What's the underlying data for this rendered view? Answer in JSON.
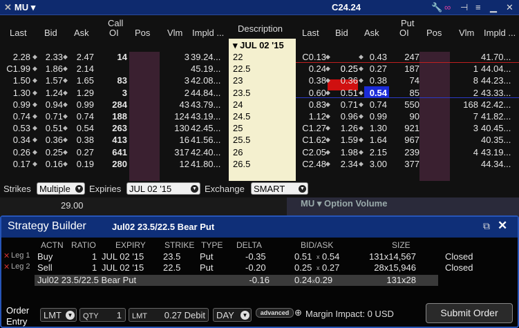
{
  "window": {
    "symbol": "MU",
    "price": "C24.24"
  },
  "chain": {
    "call_header": "Call",
    "put_header": "Put",
    "columns": {
      "last": "Last",
      "bid": "Bid",
      "ask": "Ask",
      "oi": "OI",
      "pos": "Pos",
      "vlm": "Vlm",
      "impld": "Impld ...",
      "description": "Description"
    },
    "expiry": "JUL 02 '15",
    "rows": [
      {
        "c_last": "2.28",
        "c_bid": "2.33",
        "c_ask": "2.47",
        "c_oi": "14",
        "c_vlm": "3",
        "c_impld": "39.24...",
        "strike": "22",
        "p_last": "C0.13",
        "p_bid": "",
        "p_ask": "0.43",
        "p_oi": "247",
        "p_vlm": "",
        "p_impld": "41.70..."
      },
      {
        "c_last": "C1.99",
        "c_bid": "1.86",
        "c_ask": "2.14",
        "c_oi": "",
        "c_vlm": "",
        "c_impld": "45.19...",
        "strike": "22.5",
        "p_last": "0.24",
        "p_bid": "0.25",
        "p_ask": "0.27",
        "p_oi": "187",
        "p_vlm": "1",
        "p_impld": "44.04..."
      },
      {
        "c_last": "1.50",
        "c_bid": "1.57",
        "c_ask": "1.65",
        "c_oi": "83",
        "c_vlm": "3",
        "c_impld": "42.08...",
        "strike": "23",
        "p_last": "0.38",
        "p_bid": "0.36",
        "p_ask": "0.38",
        "p_oi": "74",
        "p_vlm": "8",
        "p_impld": "44.23..."
      },
      {
        "c_last": "1.30",
        "c_bid": "1.24",
        "c_ask": "1.29",
        "c_oi": "3",
        "c_vlm": "2",
        "c_impld": "44.84...",
        "strike": "23.5",
        "p_last": "0.60",
        "p_bid": "0.51",
        "p_ask": "0.54",
        "p_oi": "85",
        "p_vlm": "2",
        "p_impld": "43.33..."
      },
      {
        "c_last": "0.99",
        "c_bid": "0.94",
        "c_ask": "0.99",
        "c_oi": "284",
        "c_vlm": "43",
        "c_impld": "43.79...",
        "strike": "24",
        "p_last": "0.83",
        "p_bid": "0.71",
        "p_ask": "0.74",
        "p_oi": "550",
        "p_vlm": "168",
        "p_impld": "42.42..."
      },
      {
        "c_last": "0.74",
        "c_bid": "0.71",
        "c_ask": "0.74",
        "c_oi": "188",
        "c_vlm": "124",
        "c_impld": "43.19...",
        "strike": "24.5",
        "p_last": "1.12",
        "p_bid": "0.96",
        "p_ask": "0.99",
        "p_oi": "90",
        "p_vlm": "7",
        "p_impld": "41.82..."
      },
      {
        "c_last": "0.53",
        "c_bid": "0.51",
        "c_ask": "0.54",
        "c_oi": "263",
        "c_vlm": "130",
        "c_impld": "42.45...",
        "strike": "25",
        "p_last": "C1.27",
        "p_bid": "1.26",
        "p_ask": "1.30",
        "p_oi": "921",
        "p_vlm": "3",
        "p_impld": "40.45..."
      },
      {
        "c_last": "0.34",
        "c_bid": "0.36",
        "c_ask": "0.38",
        "c_oi": "413",
        "c_vlm": "16",
        "c_impld": "41.56...",
        "strike": "25.5",
        "p_last": "C1.62",
        "p_bid": "1.59",
        "p_ask": "1.64",
        "p_oi": "967",
        "p_vlm": "",
        "p_impld": "40.35..."
      },
      {
        "c_last": "0.26",
        "c_bid": "0.25",
        "c_ask": "0.27",
        "c_oi": "641",
        "c_vlm": "317",
        "c_impld": "42.40...",
        "strike": "26",
        "p_last": "C2.05",
        "p_bid": "1.98",
        "p_ask": "2.15",
        "p_oi": "239",
        "p_vlm": "4",
        "p_impld": "43.19..."
      },
      {
        "c_last": "0.17",
        "c_bid": "0.16",
        "c_ask": "0.19",
        "c_oi": "280",
        "c_vlm": "12",
        "c_impld": "41.80...",
        "strike": "26.5",
        "p_last": "C2.48",
        "p_bid": "2.34",
        "p_ask": "3.00",
        "p_oi": "377",
        "p_vlm": "",
        "p_impld": "44.34..."
      }
    ]
  },
  "controls": {
    "strikes_label": "Strikes",
    "strikes_value": "Multiple",
    "expiries_label": "Expiries",
    "expiries_value": "JUL 02 '15",
    "exchange_label": "Exchange",
    "exchange_value": "SMART"
  },
  "background": {
    "price_fragment": "29.00",
    "panel_title": "MU ▾  Option Volume"
  },
  "strategy": {
    "title": "Strategy Builder",
    "subtitle": "Jul02 23.5/22.5 Bear Put",
    "headers": {
      "actn": "ACTN",
      "ratio": "RATIO",
      "expiry": "EXPIRY",
      "strike": "STRIKE",
      "type": "TYPE",
      "delta": "DELTA",
      "bidask": "BID/ASK",
      "size": "SIZE"
    },
    "legs": [
      {
        "leg": "Leg 1",
        "actn": "Buy",
        "ratio": "1",
        "expiry": "JUL 02 '15",
        "strike": "23.5",
        "type": "Put",
        "delta": "-0.35",
        "bid": "0.51",
        "ask": "0.54",
        "size": "131x14,567",
        "status": "Closed"
      },
      {
        "leg": "Leg 2",
        "actn": "Sell",
        "ratio": "1",
        "expiry": "JUL 02 '15",
        "strike": "22.5",
        "type": "Put",
        "delta": "-0.20",
        "bid": "0.25",
        "ask": "0.27",
        "size": "28x15,946",
        "status": "Closed"
      }
    ],
    "summary": {
      "name": "Jul02 23.5/22.5 Bear Put",
      "delta": "-0.16",
      "bid": "0.24",
      "ask": "0.29",
      "size": "131x28"
    },
    "order": {
      "label_1": "Order",
      "label_2": "Entry",
      "type": "LMT",
      "qty_label": "QTY",
      "qty": "1",
      "lmt_label": "LMT",
      "lmt_value": "0.27 Debit",
      "tif": "DAY",
      "advanced": "advanced",
      "margin": "Margin Impact: 0 USD",
      "submit": "Submit Order"
    }
  }
}
